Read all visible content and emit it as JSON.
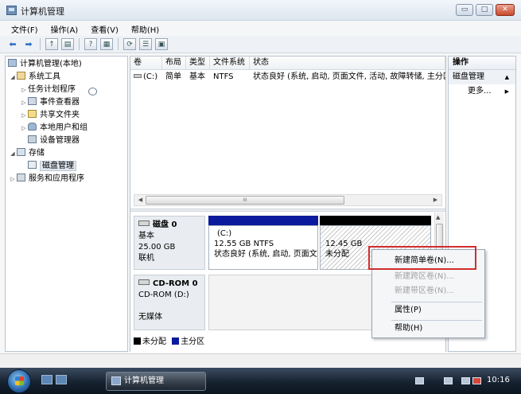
{
  "window": {
    "title": "计算机管理"
  },
  "window_controls": {
    "minimize": "▭",
    "maximize": "□",
    "close": "✕"
  },
  "menubar": [
    "文件(F)",
    "操作(A)",
    "查看(V)",
    "帮助(H)"
  ],
  "toolbar_icons": [
    "back-arrow-icon",
    "forward-arrow-icon",
    "up-folder-icon",
    "show-hide-tree-icon",
    "help-icon",
    "view-icon",
    "refresh-icon",
    "properties-icon",
    "export-icon"
  ],
  "tree": {
    "root": "计算机管理(本地)",
    "system_tools": "系统工具",
    "task_scheduler": "任务计划程序",
    "event_viewer": "事件查看器",
    "shared_folders": "共享文件夹",
    "local_users": "本地用户和组",
    "device_manager": "设备管理器",
    "storage": "存储",
    "disk_management": "磁盘管理",
    "services_apps": "服务和应用程序"
  },
  "volume_table": {
    "columns": [
      "卷",
      "布局",
      "类型",
      "文件系统",
      "状态"
    ],
    "rows": [
      {
        "volume": "(C:)",
        "layout": "简单",
        "type": "基本",
        "fs": "NTFS",
        "status": "状态良好 (系统, 启动, 页面文件, 活动, 故障转储, 主分区)"
      }
    ],
    "hscroll_grip": "III"
  },
  "disks": [
    {
      "name": "磁盘 0",
      "type": "基本",
      "size": "25.00 GB",
      "status": "联机"
    },
    {
      "name": "CD-ROM 0",
      "type": "CD-ROM (D:)",
      "size": "",
      "status": "无媒体"
    }
  ],
  "partitions": {
    "c": {
      "name": "(C:)",
      "size_fs": "12.55 GB NTFS",
      "status": "状态良好 (系统, 启动, 页面文"
    },
    "unallocated": {
      "size": "12.45 GB",
      "label": "未分配"
    }
  },
  "legend": [
    {
      "label": "未分配",
      "color": "#000000"
    },
    {
      "label": "主分区",
      "color": "#0c1a9d"
    }
  ],
  "actions": {
    "header": "操作",
    "section": "磁盘管理",
    "more": "更多..."
  },
  "context_menu": {
    "new_simple": "新建简单卷(N)...",
    "new_spanned": "新建跨区卷(N)...",
    "new_striped": "新建带区卷(N)...",
    "properties": "属性(P)",
    "help": "帮助(H)"
  },
  "taskbar": {
    "task_label": "计算机管理",
    "clock": "10:16"
  }
}
